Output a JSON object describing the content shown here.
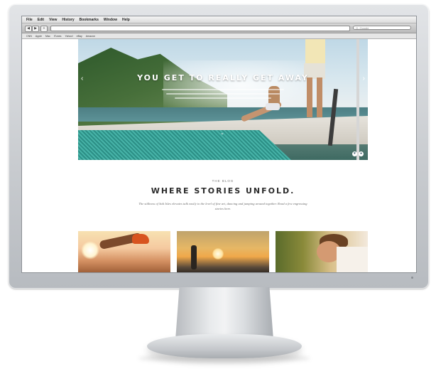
{
  "browser": {
    "menu": [
      "File",
      "Edit",
      "View",
      "History",
      "Bookmarks",
      "Window",
      "Help"
    ],
    "search_placeholder": "Q- Google",
    "bookmarks": [
      "CNN",
      "Apple",
      "Mac",
      "iTunes",
      "Yahoo!",
      "eBay",
      "Amazon"
    ]
  },
  "hero": {
    "title": "YOU GET TO REALLY GET AWAY",
    "prev_icon": "chevron-left-icon",
    "next_icon": "chevron-right-icon",
    "scroll_icon": "chevron-down-icon",
    "corner_icons": [
      "heart-icon",
      "share-icon"
    ]
  },
  "blog": {
    "eyebrow": "THE BLOG",
    "title": "WHERE STORIES UNFOLD.",
    "description": "The stillness of Salt Isles elevates talk easily to the level of fine art, dancing and jumping around together. Read a few engrossing stories here."
  },
  "thumbnails": [
    {
      "subject": "runner-legs"
    },
    {
      "subject": "sunset-figure"
    },
    {
      "subject": "couple-portrait"
    }
  ],
  "colors": {
    "net_teal": "#2c8f86",
    "heading_text": "#2b2b2b",
    "monitor_silver": "#c9ccd0"
  }
}
